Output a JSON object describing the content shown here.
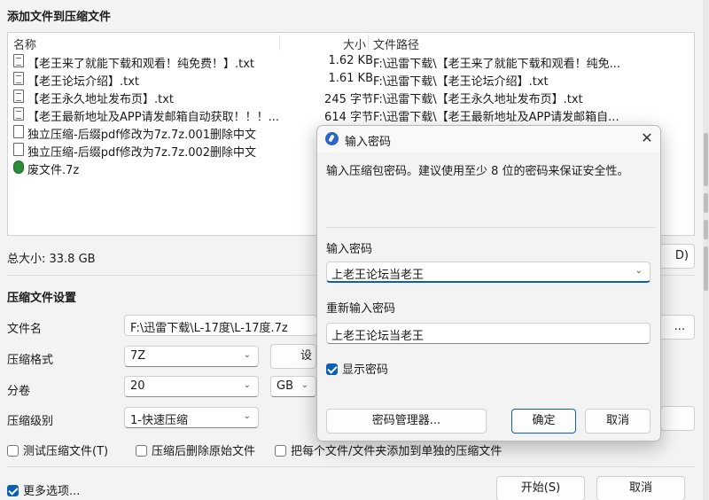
{
  "main": {
    "add_files_title": "添加文件到压缩文件",
    "columns": {
      "name": "名称",
      "size": "大小",
      "path": "文件路径"
    },
    "files": [
      {
        "name": "【老王来了就能下载和观看！纯免费！】.txt",
        "size": "1.62 KB",
        "path": "F:\\迅雷下载\\【老王来了就能下载和观看！纯免...",
        "icon": "txt-file-icon"
      },
      {
        "name": "【老王论坛介绍】.txt",
        "size": "1.61 KB",
        "path": "F:\\迅雷下载\\【老王论坛介绍】.txt",
        "icon": "txt-file-icon"
      },
      {
        "name": "【老王永久地址发布页】.txt",
        "size": "245 字节",
        "path": "F:\\迅雷下载\\【老王永久地址发布页】.txt",
        "icon": "txt-file-icon"
      },
      {
        "name": "【老王最新地址及APP请发邮箱自动获取！！！...",
        "size": "614 字节",
        "path": "F:\\迅雷下载\\【老王最新地址及APP请发邮箱自...",
        "icon": "txt-file-icon"
      },
      {
        "name": "独立压缩-后缀pdf修改为7z.7z.001删除中文",
        "size": "",
        "path": "",
        "icon": "file-icon"
      },
      {
        "name": "独立压缩-后缀pdf修改为7z.7z.002删除中文",
        "size": "",
        "path": "",
        "icon": "file-icon"
      },
      {
        "name": "废文件.7z",
        "size": "",
        "path": "",
        "icon": "archive-icon"
      }
    ],
    "total_size": "总大小: 33.8 GB",
    "settings_title": "压缩文件设置",
    "filename_label": "文件名",
    "filename_value": "F:\\迅雷下载\\L-17度\\L-17度.7z",
    "browse_label": "...",
    "format_label": "压缩格式",
    "format_value": "7Z",
    "format_settings_button": "设",
    "split_label": "分卷",
    "split_value": "20",
    "split_unit": "GB",
    "level_label": "压缩级别",
    "level_value": "1-快速压缩",
    "partial_button_right": "D)",
    "options": {
      "test": "测试压缩文件(T)",
      "delete_after": "压缩后删除原始文件",
      "separate": "把每个文件/文件夹添加到单独的压缩文件",
      "more": "更多选项..."
    },
    "start_button": "开始(S)",
    "cancel_button": "取消"
  },
  "dialog": {
    "title": "输入密码",
    "close": "✕",
    "description": "输入压缩包密码。建议使用至少 8 位的密码来保证安全性。",
    "password_label": "输入密码",
    "password_value": "上老王论坛当老王",
    "confirm_label": "重新输入密码",
    "confirm_value": "上老王论坛当老王",
    "show_password": "显示密码",
    "manager_button": "密码管理器...",
    "ok_button": "确定",
    "cancel_button": "取消"
  },
  "colors": {
    "accent": "#0a5fb4",
    "background": "#f3f3f3"
  }
}
